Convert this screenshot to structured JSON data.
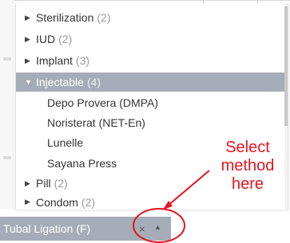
{
  "dropdown": {
    "groups_top": [
      {
        "label": "Sterilization",
        "count": "(2)"
      },
      {
        "label": "IUD",
        "count": "(2)"
      },
      {
        "label": "Implant",
        "count": "(3)"
      }
    ],
    "expanded_group": {
      "label": "Injectable",
      "count": "(4)"
    },
    "children": [
      "Depo Provera (DMPA)",
      "Noristerat (NET-En)",
      "Lunelle",
      "Sayana Press"
    ],
    "groups_bottom": [
      {
        "label": "Pill",
        "count": "(2)"
      },
      {
        "label": "Condom",
        "count": "(2)"
      }
    ]
  },
  "select": {
    "value": "Tubal Ligation (F)",
    "clear_glyph": "×",
    "arrow_glyph": "▲"
  },
  "annotation": {
    "line1": "Select",
    "line2": "method",
    "line3": "here",
    "color": "#e8141e"
  },
  "icons": {
    "collapsed_caret": "▶",
    "expanded_caret": "▼"
  },
  "colors": {
    "highlight": "#a4adb7",
    "annotation_red": "#e8141e"
  }
}
